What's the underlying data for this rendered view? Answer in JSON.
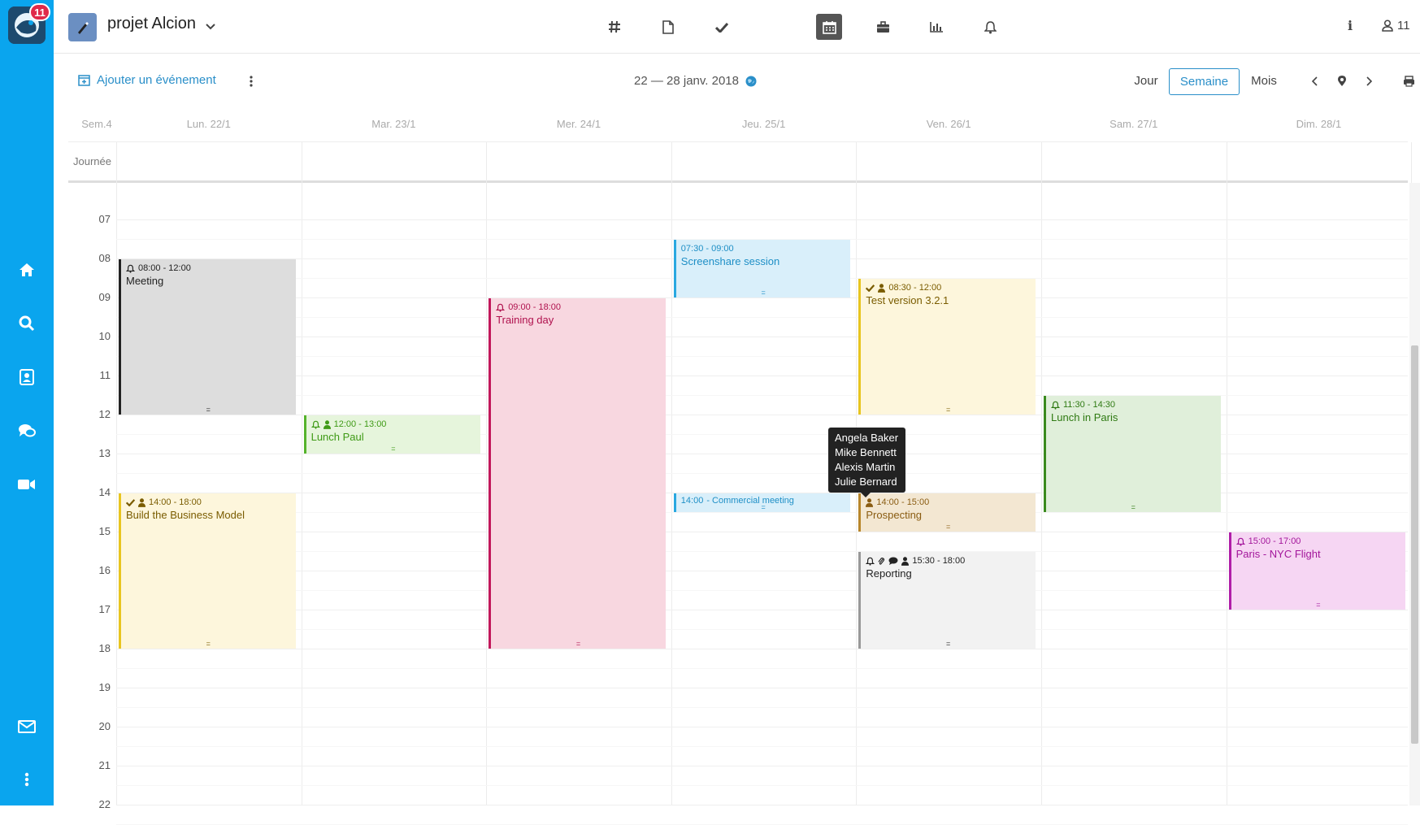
{
  "sidebar": {
    "notification_count": "11",
    "icons": [
      "home-icon",
      "search-icon",
      "contacts-icon",
      "chat-icon",
      "video-icon",
      "mail-icon",
      "more-icon"
    ]
  },
  "topbar": {
    "project_title": "projet Alcion",
    "tools": [
      "hash-icon",
      "file-icon",
      "check-icon",
      "calendar-icon",
      "briefcase-icon",
      "chart-icon",
      "bell-icon"
    ],
    "active_tool": "calendar-icon",
    "info_label": "i",
    "user_count": "11"
  },
  "toolbar": {
    "add_event_label": "Ajouter un événement",
    "date_range": "22 — 28 janv. 2018",
    "views": [
      "Jour",
      "Semaine",
      "Mois"
    ],
    "active_view": "Semaine"
  },
  "grid": {
    "week_label": "Sem.4",
    "allday_label": "Journée",
    "days": [
      "Lun. 22/1",
      "Mar. 23/1",
      "Mer. 24/1",
      "Jeu. 25/1",
      "Ven. 26/1",
      "Sam. 27/1",
      "Dim. 28/1"
    ],
    "hours": [
      "07",
      "08",
      "09",
      "10",
      "11",
      "12",
      "13",
      "14",
      "15",
      "16",
      "17",
      "18",
      "19",
      "20",
      "21",
      "22"
    ]
  },
  "events": [
    {
      "day": 0,
      "time": "08:00 - 12:00",
      "title": "Meeting",
      "color": "#222222",
      "bg": "#dddddd",
      "text": "#222222",
      "icons": [
        "bell"
      ]
    },
    {
      "day": 0,
      "time": "14:00 - 18:00",
      "title": "Build the Business Model",
      "color": "#e8c520",
      "bg": "#fdf6dc",
      "text": "#7a5c00",
      "icons": [
        "check",
        "user"
      ]
    },
    {
      "day": 1,
      "time": "12:00 - 13:00",
      "title": "Lunch Paul",
      "color": "#55b32b",
      "bg": "#e6f5dc",
      "text": "#3e9a15",
      "icons": [
        "bell",
        "user"
      ]
    },
    {
      "day": 2,
      "time": "09:00 - 18:00",
      "title": "Training day",
      "color": "#c2185b",
      "bg": "#f8d7e0",
      "text": "#b0124e",
      "icons": [
        "bell"
      ]
    },
    {
      "day": 3,
      "time": "07:30 - 09:00",
      "title": "Screenshare session",
      "color": "#29a8e0",
      "bg": "#d9effa",
      "text": "#1e8fc6",
      "icons": []
    },
    {
      "day": 3,
      "time": "14:00",
      "title": "- Commercial meeting",
      "color": "#29a8e0",
      "bg": "#d9effa",
      "text": "#1e8fc6",
      "icons": [],
      "inline": true
    },
    {
      "day": 4,
      "time": "08:30 - 12:00",
      "title": "Test version 3.2.1",
      "color": "#e8c520",
      "bg": "#fdf6dc",
      "text": "#7a5c00",
      "icons": [
        "check",
        "user"
      ]
    },
    {
      "day": 4,
      "time": "14:00 - 15:00",
      "title": "Prospecting",
      "color": "#b8862b",
      "bg": "#f3e7d2",
      "text": "#8a5c12",
      "icons": [
        "user"
      ]
    },
    {
      "day": 4,
      "time": "15:30 - 18:00",
      "title": "Reporting",
      "color": "#999999",
      "bg": "#f2f2f2",
      "text": "#222222",
      "icons": [
        "bell",
        "clip",
        "comment",
        "user"
      ]
    },
    {
      "day": 5,
      "time": "11:30 - 14:30",
      "title": "Lunch in Paris",
      "color": "#3a8a1e",
      "bg": "#e0efda",
      "text": "#2f7a13",
      "icons": [
        "bell"
      ]
    },
    {
      "day": 6,
      "time": "15:00 - 17:00",
      "title": "Paris - NYC Flight",
      "color": "#b01ea8",
      "bg": "#f6d6f3",
      "text": "#a3169b",
      "icons": [
        "bell"
      ]
    }
  ],
  "tooltip": {
    "names": [
      "Angela Baker",
      "Mike Bennett",
      "Alexis Martin",
      "Julie Bernard"
    ]
  }
}
